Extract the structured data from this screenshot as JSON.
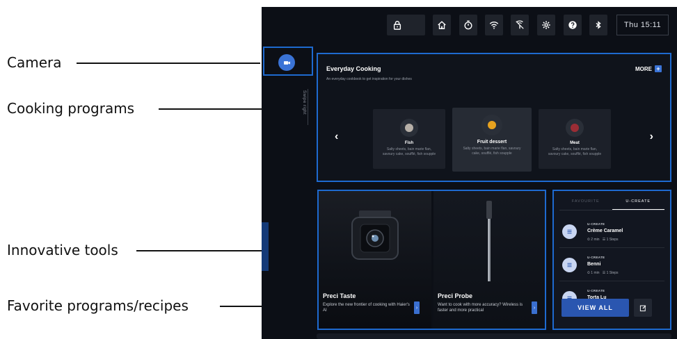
{
  "callouts": {
    "camera": "Camera",
    "cooking_programs": "Cooking programs",
    "innovative_tools": "Innovative tools",
    "favorites": "Favorite programs/recipes"
  },
  "statusbar": {
    "icons": [
      "lock-icon",
      "home-icon",
      "timer-icon",
      "wifi-icon",
      "wifi-off-icon",
      "gear-icon",
      "help-icon",
      "bluetooth-icon"
    ],
    "clock": "Thu 15:11"
  },
  "side": {
    "swipe_text": "Swipe right"
  },
  "everyday": {
    "title": "Everyday Cooking",
    "subtitle": "An everyday cookbook to get inspiration for your dishes",
    "more": "MORE",
    "more_plus": "+",
    "prev": "‹",
    "next": "›",
    "cards": [
      {
        "name": "Fish",
        "desc": "Salty sheets, bain marie flan, savoury cake, soufflé, fish soupple"
      },
      {
        "name": "Fruit dessert",
        "desc": "Salty sheets, bain marie flan, savoury cake, soufflé, fish soupple"
      },
      {
        "name": "Meat",
        "desc": "Salty sheets, bain marie flan, savoury cake, soufflé, fish soupple"
      }
    ]
  },
  "tools": [
    {
      "title": "Preci Taste",
      "desc": "Explore the new frontier of cooking with Haier's AI"
    },
    {
      "title": "Preci Probe",
      "desc": "Want to cook with more accuracy? Wireless is faster and more practical"
    }
  ],
  "favorites": {
    "tabs": [
      "FAVOURITE",
      "U-CREATE"
    ],
    "items": [
      {
        "kicker": "U-CREATE",
        "name": "Crème Caramel",
        "time": "2 min",
        "steps": "1 Steps"
      },
      {
        "kicker": "U-CREATE",
        "name": "Benni",
        "time": "1 min",
        "steps": "1 Steps"
      },
      {
        "kicker": "U-CREATE",
        "name": "Torta Lu",
        "time": "",
        "steps": ""
      }
    ],
    "view_all": "VIEW ALL"
  },
  "colors": {
    "accent": "#1e6ad0",
    "button": "#2a56b0",
    "background": "#0c0f16"
  }
}
